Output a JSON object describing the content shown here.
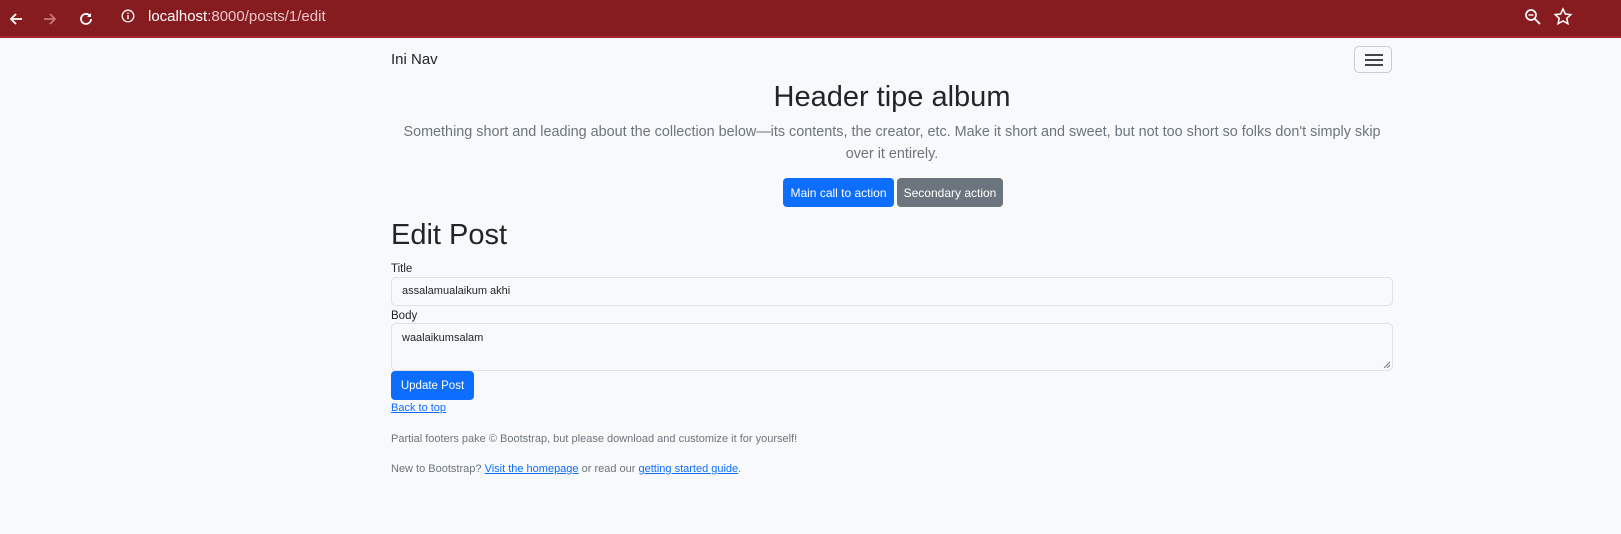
{
  "browser": {
    "url_host": "localhost",
    "url_path": ":8000/posts/1/edit",
    "icons": [
      "back-icon",
      "forward-icon",
      "reload-icon",
      "info-icon",
      "zoom-icon",
      "star-icon"
    ],
    "bar_color": "#861c1f"
  },
  "navbar": {
    "brand": "Ini Nav",
    "toggler_icon": "hamburger-icon"
  },
  "hero": {
    "title": "Header tipe album",
    "lead": "Something short and leading about the collection below—its contents, the creator, etc. Make it short and sweet, but not too short so folks don't simply skip over it entirely.",
    "primary_label": "Main call to action",
    "secondary_label": "Secondary action"
  },
  "form": {
    "heading": "Edit Post",
    "title_label": "Title",
    "title_value": "assalamualaikum akhi",
    "body_label": "Body",
    "body_value": "waalaikumsalam",
    "submit_label": "Update Post"
  },
  "footer": {
    "back_to_top": "Back to top",
    "line1": "Partial footers pake © Bootstrap, but please download and customize it for yourself!",
    "line2_prefix": "New to Bootstrap?",
    "homepage_link": "Visit the homepage",
    "line2_middle": "or read our",
    "guide_link": "getting started guide",
    "line2_suffix": "."
  },
  "colors": {
    "primary": "#0d6efd",
    "secondary": "#6c757d",
    "page_bg": "#f8f9fa"
  }
}
